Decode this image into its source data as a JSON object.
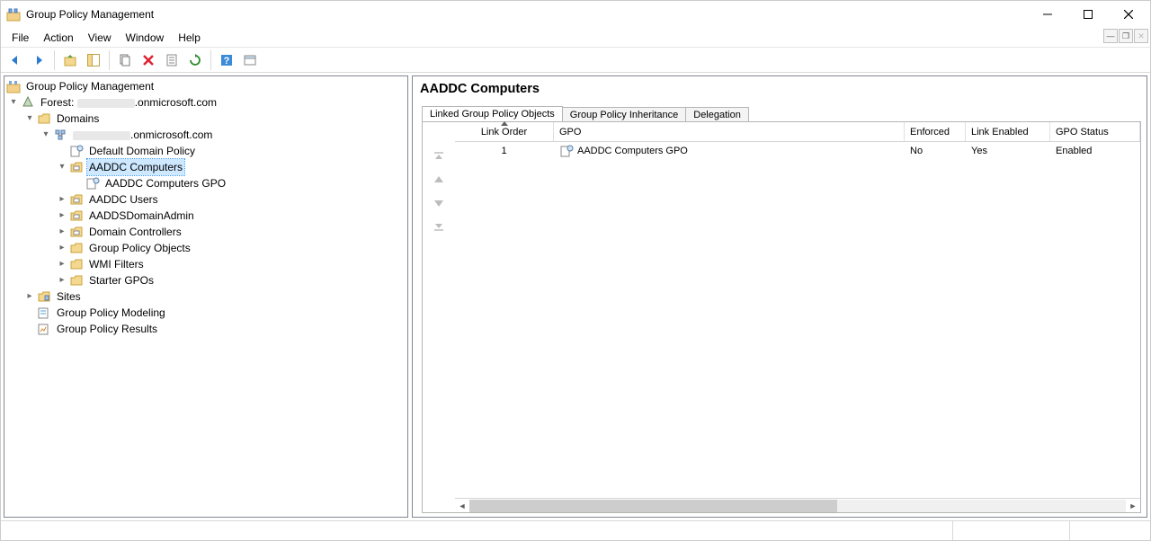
{
  "window": {
    "title": "Group Policy Management"
  },
  "menu": {
    "file": "File",
    "action": "Action",
    "view": "View",
    "window": "Window",
    "help": "Help"
  },
  "tree": {
    "root": "Group Policy Management",
    "forest_prefix": "Forest: ",
    "forest_suffix": ".onmicrosoft.com",
    "domains": "Domains",
    "domain_suffix": ".onmicrosoft.com",
    "default_domain_policy": "Default Domain Policy",
    "aaddc_computers": "AADDC Computers",
    "aaddc_computers_gpo": "AADDC Computers GPO",
    "aaddc_users": "AADDC Users",
    "aadds_domain_admin": "AADDSDomainAdmin",
    "domain_controllers": "Domain Controllers",
    "group_policy_objects": "Group Policy Objects",
    "wmi_filters": "WMI Filters",
    "starter_gpos": "Starter GPOs",
    "sites": "Sites",
    "modeling": "Group Policy Modeling",
    "results": "Group Policy Results"
  },
  "content": {
    "title": "AADDC Computers",
    "tabs": {
      "linked": "Linked Group Policy Objects",
      "inheritance": "Group Policy Inheritance",
      "delegation": "Delegation"
    },
    "columns": {
      "link_order": "Link Order",
      "gpo": "GPO",
      "enforced": "Enforced",
      "link_enabled": "Link Enabled",
      "gpo_status": "GPO Status"
    },
    "rows": [
      {
        "order": "1",
        "gpo": "AADDC Computers GPO",
        "enforced": "No",
        "link_enabled": "Yes",
        "gpo_status": "Enabled"
      }
    ]
  }
}
